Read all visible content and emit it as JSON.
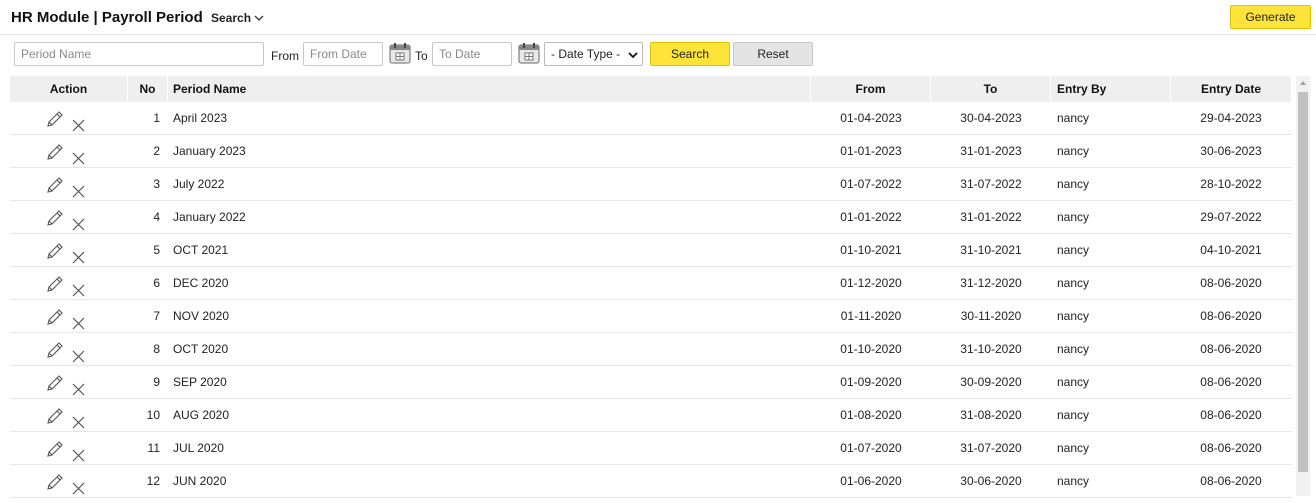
{
  "header": {
    "title": "HR Module | Payroll Period",
    "search_menu_label": "Search",
    "generate_label": "Generate"
  },
  "filters": {
    "period_name_placeholder": "Period Name",
    "from_label": "From",
    "from_date_placeholder": "From Date",
    "to_label": "To",
    "to_date_placeholder": "To Date",
    "date_type_selected": "- Date Type -",
    "search_label": "Search",
    "reset_label": "Reset"
  },
  "table": {
    "columns": {
      "action": "Action",
      "no": "No",
      "period_name": "Period Name",
      "from": "From",
      "to": "To",
      "entry_by": "Entry By",
      "entry_date": "Entry Date"
    },
    "rows": [
      {
        "no": "1",
        "period_name": "April 2023",
        "from": "01-04-2023",
        "to": "30-04-2023",
        "entry_by": "nancy",
        "entry_date": "29-04-2023"
      },
      {
        "no": "2",
        "period_name": "January 2023",
        "from": "01-01-2023",
        "to": "31-01-2023",
        "entry_by": "nancy",
        "entry_date": "30-06-2023"
      },
      {
        "no": "3",
        "period_name": "July 2022",
        "from": "01-07-2022",
        "to": "31-07-2022",
        "entry_by": "nancy",
        "entry_date": "28-10-2022"
      },
      {
        "no": "4",
        "period_name": "January 2022",
        "from": "01-01-2022",
        "to": "31-01-2022",
        "entry_by": "nancy",
        "entry_date": "29-07-2022"
      },
      {
        "no": "5",
        "period_name": "OCT 2021",
        "from": "01-10-2021",
        "to": "31-10-2021",
        "entry_by": "nancy",
        "entry_date": "04-10-2021"
      },
      {
        "no": "6",
        "period_name": "DEC 2020",
        "from": "01-12-2020",
        "to": "31-12-2020",
        "entry_by": "nancy",
        "entry_date": "08-06-2020"
      },
      {
        "no": "7",
        "period_name": "NOV 2020",
        "from": "01-11-2020",
        "to": "30-11-2020",
        "entry_by": "nancy",
        "entry_date": "08-06-2020"
      },
      {
        "no": "8",
        "period_name": "OCT 2020",
        "from": "01-10-2020",
        "to": "31-10-2020",
        "entry_by": "nancy",
        "entry_date": "08-06-2020"
      },
      {
        "no": "9",
        "period_name": "SEP 2020",
        "from": "01-09-2020",
        "to": "30-09-2020",
        "entry_by": "nancy",
        "entry_date": "08-06-2020"
      },
      {
        "no": "10",
        "period_name": "AUG 2020",
        "from": "01-08-2020",
        "to": "31-08-2020",
        "entry_by": "nancy",
        "entry_date": "08-06-2020"
      },
      {
        "no": "11",
        "period_name": "JUL 2020",
        "from": "01-07-2020",
        "to": "31-07-2020",
        "entry_by": "nancy",
        "entry_date": "08-06-2020"
      },
      {
        "no": "12",
        "period_name": "JUN 2020",
        "from": "01-06-2020",
        "to": "30-06-2020",
        "entry_by": "nancy",
        "entry_date": "08-06-2020"
      }
    ]
  },
  "icons": {
    "edit": "pencil-icon",
    "delete": "close-icon",
    "calendar": "calendar-icon",
    "dropdown": "chevron-down-icon"
  },
  "colors": {
    "accent_yellow": "#fde33a",
    "header_bg": "#efefef",
    "reset_bg": "#e4e4e4"
  }
}
